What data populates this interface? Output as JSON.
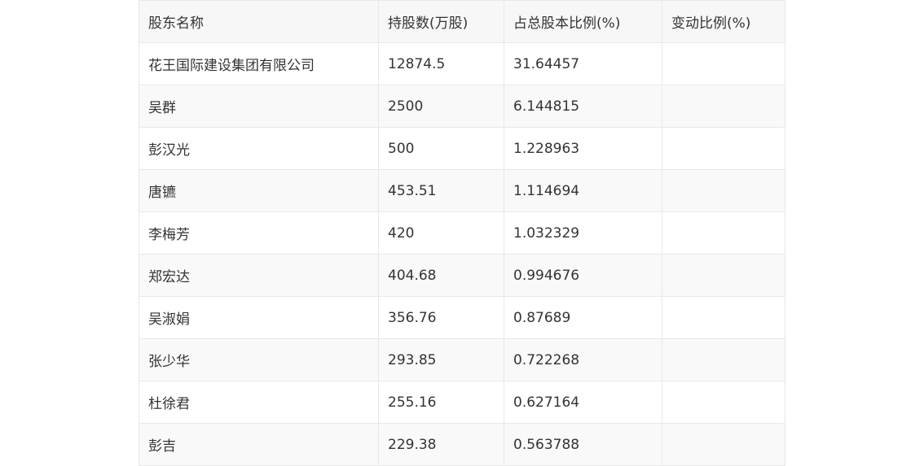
{
  "table": {
    "headers": [
      "股东名称",
      "持股数(万股)",
      "占总股本比例(%)",
      "变动比例(%)"
    ],
    "rows": [
      [
        "花王国际建设集团有限公司",
        "12874.5",
        "31.64457",
        ""
      ],
      [
        "吴群",
        "2500",
        "6.144815",
        ""
      ],
      [
        "彭汉光",
        "500",
        "1.228963",
        ""
      ],
      [
        "唐镳",
        "453.51",
        "1.114694",
        ""
      ],
      [
        "李梅芳",
        "420",
        "1.032329",
        ""
      ],
      [
        "郑宏达",
        "404.68",
        "0.994676",
        ""
      ],
      [
        "吴淑娟",
        "356.76",
        "0.87689",
        ""
      ],
      [
        "张少华",
        "293.85",
        "0.722268",
        ""
      ],
      [
        "杜徐君",
        "255.16",
        "0.627164",
        ""
      ],
      [
        "彭吉",
        "229.38",
        "0.563788",
        ""
      ]
    ]
  }
}
